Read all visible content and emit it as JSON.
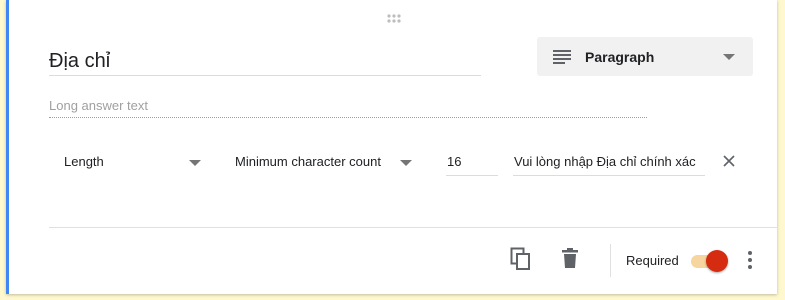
{
  "question": {
    "title": "Địa chỉ",
    "answer_hint": "Long answer text",
    "type_label": "Paragraph"
  },
  "validation": {
    "rule_type": "Length",
    "condition": "Minimum character count",
    "value": "16",
    "error_text": "Vui lòng nhập Địa chỉ chính xác"
  },
  "footer": {
    "required_label": "Required",
    "required_on": true
  },
  "icons": {
    "drag": "drag-handle-icon",
    "paragraph": "paragraph-icon",
    "dropdown": "caret-down-icon",
    "close": "close-icon",
    "duplicate": "copy-icon",
    "delete": "trash-icon",
    "more": "more-vert-icon"
  },
  "colors": {
    "accent": "#4285f4",
    "toggle_thumb": "#d52b11",
    "toggle_track": "#f6d59e",
    "background": "#fff8cf"
  }
}
